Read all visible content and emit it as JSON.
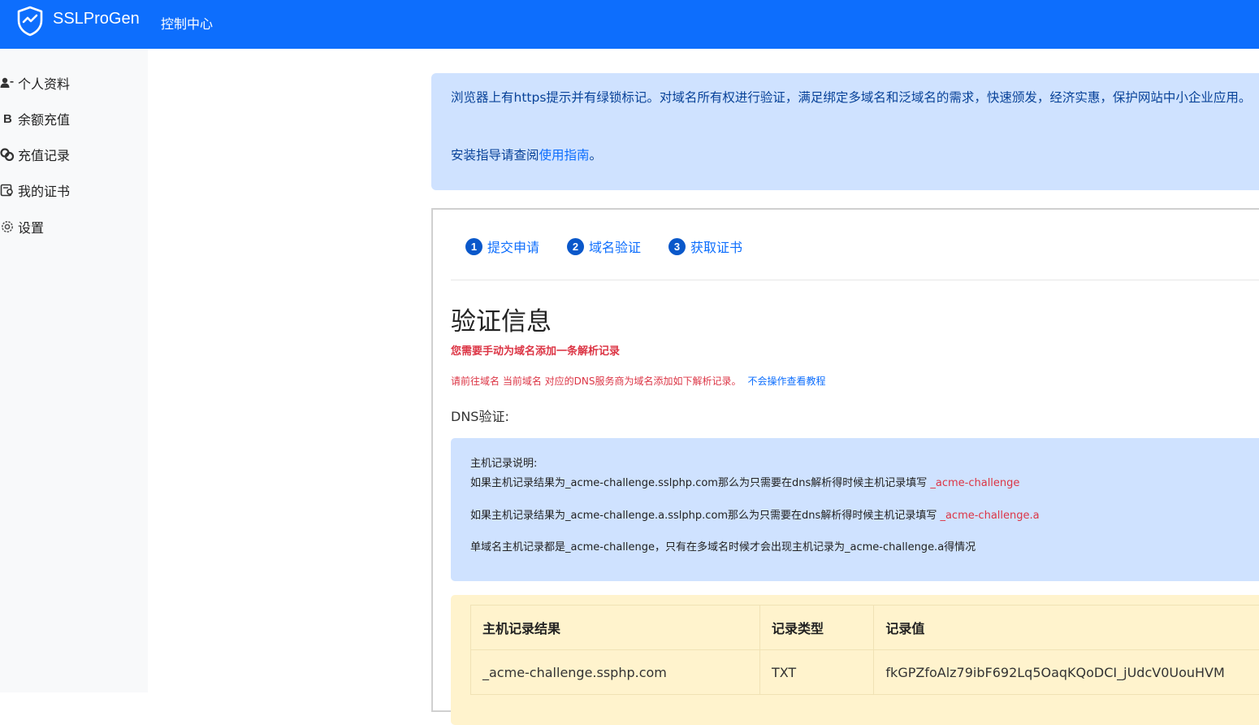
{
  "header": {
    "brand": "SSLProGen",
    "subtitle": "控制中心",
    "icon": "shield-check-icon",
    "color": "#0d6efd"
  },
  "sidebar": {
    "items": [
      {
        "label": "个人资料",
        "icon": "user-icon"
      },
      {
        "label": "余额充值",
        "icon": "bitcoin-icon"
      },
      {
        "label": "充值记录",
        "icon": "coins-icon"
      },
      {
        "label": "我的证书",
        "icon": "certificate-icon"
      },
      {
        "label": "设置",
        "icon": "gear-icon"
      }
    ]
  },
  "info_alert": {
    "text": "浏览器上有https提示并有绿锁标记。对域名所有权进行验证，满足绑定多域名和泛域名的需求，快速颁发，经济实惠，保护网站中小企业应用。",
    "guide_prefix": "安装指导请查阅",
    "guide_link": "使用指南",
    "guide_suffix": "。"
  },
  "steps": [
    {
      "num": "1",
      "label": "提交申请"
    },
    {
      "num": "2",
      "label": "域名验证"
    },
    {
      "num": "3",
      "label": "获取证书"
    }
  ],
  "verify": {
    "title": "验证信息",
    "warning": "您需要手动为域名添加一条解析记录",
    "instruction": "请前往域名 当前域名 对应的DNS服务商为域名添加如下解析记录。",
    "help_link": "不会操作查看教程",
    "dns_label": "DNS验证:"
  },
  "host_notes": {
    "heading": "主机记录说明:",
    "line1_prefix": "如果主机记录结果为_acme-challenge.sslphp.com那么为只需要在dns解析得时候主机记录填写",
    "line1_value": "_acme-challenge",
    "line2_prefix": "如果主机记录结果为_acme-challenge.a.sslphp.com那么为只需要在dns解析得时候主机记录填写",
    "line2_value": "_acme-challenge.a",
    "line3": "单域名主机记录都是_acme-challenge，只有在多域名时候才会出现主机记录为_acme-challenge.a得情况"
  },
  "record_table": {
    "headers": [
      "主机记录结果",
      "记录类型",
      "记录值"
    ],
    "rows": [
      [
        "_acme-challenge.ssphp.com",
        "TXT",
        "fkGPZfoAlz79ibF692Lq5OaqKQoDCI_jUdcV0UouHVM"
      ]
    ]
  }
}
